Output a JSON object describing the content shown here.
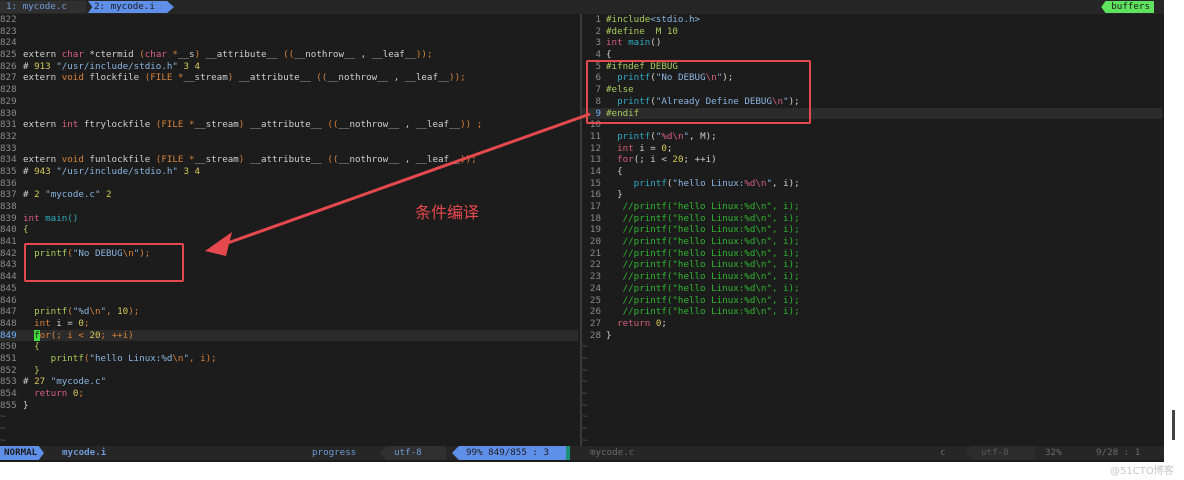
{
  "tabs": [
    {
      "label": "1: mycode.c"
    },
    {
      "label": "2: mycode.i"
    }
  ],
  "buffers_label": "buffers",
  "left_pane": {
    "start": 822,
    "cursor_line": 849,
    "tildes": 3,
    "lines": [
      [],
      [],
      [],
      [
        [
          "extern ",
          "d"
        ],
        [
          "char",
          "k"
        ],
        [
          " *ctermid ",
          "d"
        ],
        [
          "(",
          "o"
        ],
        [
          "char",
          "k"
        ],
        [
          " *",
          "o"
        ],
        [
          "__s",
          "d"
        ],
        [
          ")",
          "o"
        ],
        [
          " __attribute__ ",
          "d"
        ],
        [
          "((",
          "o"
        ],
        [
          "__nothrow__ , __leaf__",
          "d"
        ],
        [
          "));",
          "o"
        ]
      ],
      [
        [
          "# ",
          "d"
        ],
        [
          "913",
          "y"
        ],
        [
          " \"/usr/include/stdio.h\"",
          "s"
        ],
        [
          " 3 4",
          "y"
        ]
      ],
      [
        [
          "extern ",
          "d"
        ],
        [
          "void",
          "o"
        ],
        [
          " flockfile ",
          "d"
        ],
        [
          "(FILE *",
          "o"
        ],
        [
          "__stream",
          "d"
        ],
        [
          ")",
          "o"
        ],
        [
          " __attribute__ ",
          "d"
        ],
        [
          "((",
          "o"
        ],
        [
          "__nothrow__ , __leaf__",
          "d"
        ],
        [
          "));",
          "o"
        ]
      ],
      [],
      [],
      [],
      [
        [
          "extern ",
          "d"
        ],
        [
          "int",
          "k"
        ],
        [
          " ftrylockfile ",
          "d"
        ],
        [
          "(FILE *",
          "o"
        ],
        [
          "__stream",
          "d"
        ],
        [
          ")",
          "o"
        ],
        [
          " __attribute__ ",
          "d"
        ],
        [
          "((",
          "o"
        ],
        [
          "__nothrow__ , __leaf__",
          "d"
        ],
        [
          ")) ;",
          "o"
        ]
      ],
      [],
      [],
      [
        [
          "extern ",
          "d"
        ],
        [
          "void",
          "o"
        ],
        [
          " funlockfile ",
          "d"
        ],
        [
          "(FILE *",
          "o"
        ],
        [
          "__stream",
          "d"
        ],
        [
          ")",
          "o"
        ],
        [
          " __attribute__ ",
          "d"
        ],
        [
          "((",
          "o"
        ],
        [
          "__nothrow__ , __leaf__",
          "d"
        ],
        [
          "));",
          "o"
        ]
      ],
      [
        [
          "# ",
          "d"
        ],
        [
          "943",
          "y"
        ],
        [
          " \"/usr/include/stdio.h\"",
          "s"
        ],
        [
          " 3 4",
          "y"
        ]
      ],
      [],
      [
        [
          "# ",
          "d"
        ],
        [
          "2",
          "y"
        ],
        [
          " \"mycode.c\"",
          "s"
        ],
        [
          " 2",
          "y"
        ]
      ],
      [],
      [
        [
          "int",
          "k"
        ],
        [
          " main()",
          "f"
        ]
      ],
      [
        [
          "{",
          "p"
        ]
      ],
      [],
      [
        [
          "  printf",
          "p"
        ],
        [
          "(",
          "o"
        ],
        [
          "\"No DEBUG",
          "s"
        ],
        [
          "\\n",
          "o"
        ],
        [
          "\"",
          "s"
        ],
        [
          ");",
          "o"
        ]
      ],
      [],
      [],
      [],
      [],
      [
        [
          "  printf",
          "p"
        ],
        [
          "(",
          "o"
        ],
        [
          "\"%d",
          "s"
        ],
        [
          "\\n",
          "o"
        ],
        [
          "\"",
          "s"
        ],
        [
          ", ",
          "o"
        ],
        [
          "10",
          "y"
        ],
        [
          ");",
          "o"
        ]
      ],
      [
        [
          "  ",
          "d"
        ],
        [
          "int",
          "o"
        ],
        [
          " i = ",
          "d"
        ],
        [
          "0",
          "y"
        ],
        [
          ";",
          "o"
        ]
      ],
      [
        [
          "  ",
          "d"
        ],
        [
          "f",
          "cursor"
        ],
        [
          "or",
          "o"
        ],
        [
          "(; i < ",
          "o"
        ],
        [
          "20",
          "y"
        ],
        [
          "; ++i)",
          "o"
        ]
      ],
      [
        [
          "  {",
          "p"
        ]
      ],
      [
        [
          "     printf",
          "p"
        ],
        [
          "(",
          "o"
        ],
        [
          "\"hello Linux:%d",
          "s"
        ],
        [
          "\\n",
          "o"
        ],
        [
          "\"",
          "s"
        ],
        [
          ", i);",
          "o"
        ]
      ],
      [
        [
          "  }",
          "p"
        ]
      ],
      [
        [
          "# ",
          "d"
        ],
        [
          "27",
          "y"
        ],
        [
          " \"mycode.c\"",
          "s"
        ]
      ],
      [
        [
          "  ",
          "d"
        ],
        [
          "return",
          "k"
        ],
        [
          " ",
          "d"
        ],
        [
          "0",
          "y"
        ],
        [
          ";",
          "o"
        ]
      ],
      [
        [
          "}",
          "d"
        ]
      ]
    ]
  },
  "right_pane": {
    "start": 1,
    "cursor_line": 9,
    "tildes": 9,
    "lines": [
      [
        [
          "#include",
          "p"
        ],
        [
          "<stdio.h>",
          "s"
        ]
      ],
      [
        [
          "#define  M 10",
          "p"
        ]
      ],
      [
        [
          "int",
          "k"
        ],
        [
          " main",
          "f"
        ],
        [
          "()",
          "d"
        ]
      ],
      [
        [
          "{",
          "d"
        ]
      ],
      [
        [
          "#ifndef DEBUG",
          "p"
        ]
      ],
      [
        [
          "  printf",
          "f"
        ],
        [
          "(",
          "d"
        ],
        [
          "\"No DEBUG",
          "s"
        ],
        [
          "\\n",
          "k"
        ],
        [
          "\"",
          "s"
        ],
        [
          ");",
          "d"
        ]
      ],
      [
        [
          "#else",
          "p"
        ]
      ],
      [
        [
          "  printf",
          "f"
        ],
        [
          "(",
          "d"
        ],
        [
          "\"Already Define DEBUG",
          "s"
        ],
        [
          "\\n",
          "k"
        ],
        [
          "\"",
          "s"
        ],
        [
          ");",
          "d"
        ]
      ],
      [
        [
          "#endif",
          "p"
        ]
      ],
      [],
      [
        [
          "  printf",
          "f"
        ],
        [
          "(",
          "d"
        ],
        [
          "\"",
          "s"
        ],
        [
          "%d\\n",
          "k"
        ],
        [
          "\"",
          "s"
        ],
        [
          ", M);",
          "d"
        ]
      ],
      [
        [
          "  ",
          "d"
        ],
        [
          "int",
          "k"
        ],
        [
          " i = ",
          "d"
        ],
        [
          "0",
          "y"
        ],
        [
          ";",
          "d"
        ]
      ],
      [
        [
          "  ",
          "d"
        ],
        [
          "for",
          "k"
        ],
        [
          "(; i < ",
          "d"
        ],
        [
          "20",
          "y"
        ],
        [
          "; ++i)",
          "d"
        ]
      ],
      [
        [
          "  {",
          "d"
        ]
      ],
      [
        [
          "     printf",
          "f"
        ],
        [
          "(",
          "d"
        ],
        [
          "\"hello Linux:",
          "s"
        ],
        [
          "%d\\n",
          "k"
        ],
        [
          "\"",
          "s"
        ],
        [
          ", i);",
          "d"
        ]
      ],
      [
        [
          "  }",
          "d"
        ]
      ],
      [
        [
          "   //printf(\"hello Linux:%d\\n\", i);",
          "c"
        ]
      ],
      [
        [
          "   //printf(\"hello Linux:%d\\n\", i);",
          "c"
        ]
      ],
      [
        [
          "   //printf(\"hello Linux:%d\\n\", i);",
          "c"
        ]
      ],
      [
        [
          "   //printf(\"hello Linux:%d\\n\", i);",
          "c"
        ]
      ],
      [
        [
          "   //printf(\"hello Linux:%d\\n\", i);",
          "c"
        ]
      ],
      [
        [
          "   //printf(\"hello Linux:%d\\n\", i);",
          "c"
        ]
      ],
      [
        [
          "   //printf(\"hello Linux:%d\\n\", i);",
          "c"
        ]
      ],
      [
        [
          "   //printf(\"hello Linux:%d\\n\", i);",
          "c"
        ]
      ],
      [
        [
          "   //printf(\"hello Linux:%d\\n\", i);",
          "c"
        ]
      ],
      [
        [
          "   //printf(\"hello Linux:%d\\n\", i);",
          "c"
        ]
      ],
      [
        [
          "  ",
          "d"
        ],
        [
          "return",
          "k"
        ],
        [
          " ",
          "d"
        ],
        [
          "0",
          "y"
        ],
        [
          ";",
          "d"
        ]
      ],
      [
        [
          "}",
          "d"
        ]
      ]
    ]
  },
  "status_left": {
    "mode": "NORMAL",
    "file": "mycode.i",
    "progress": "progress",
    "encoding": "utf-8",
    "position": "99%  849/855 :  3"
  },
  "status_right": {
    "file": "mycode.c",
    "filetype": "c",
    "encoding": "utf-8",
    "percent": "32%",
    "position": "9/28 :  1"
  },
  "annotation": {
    "label": "条件编译",
    "color": "#e5484d"
  },
  "watermark": "@51CTO博客"
}
